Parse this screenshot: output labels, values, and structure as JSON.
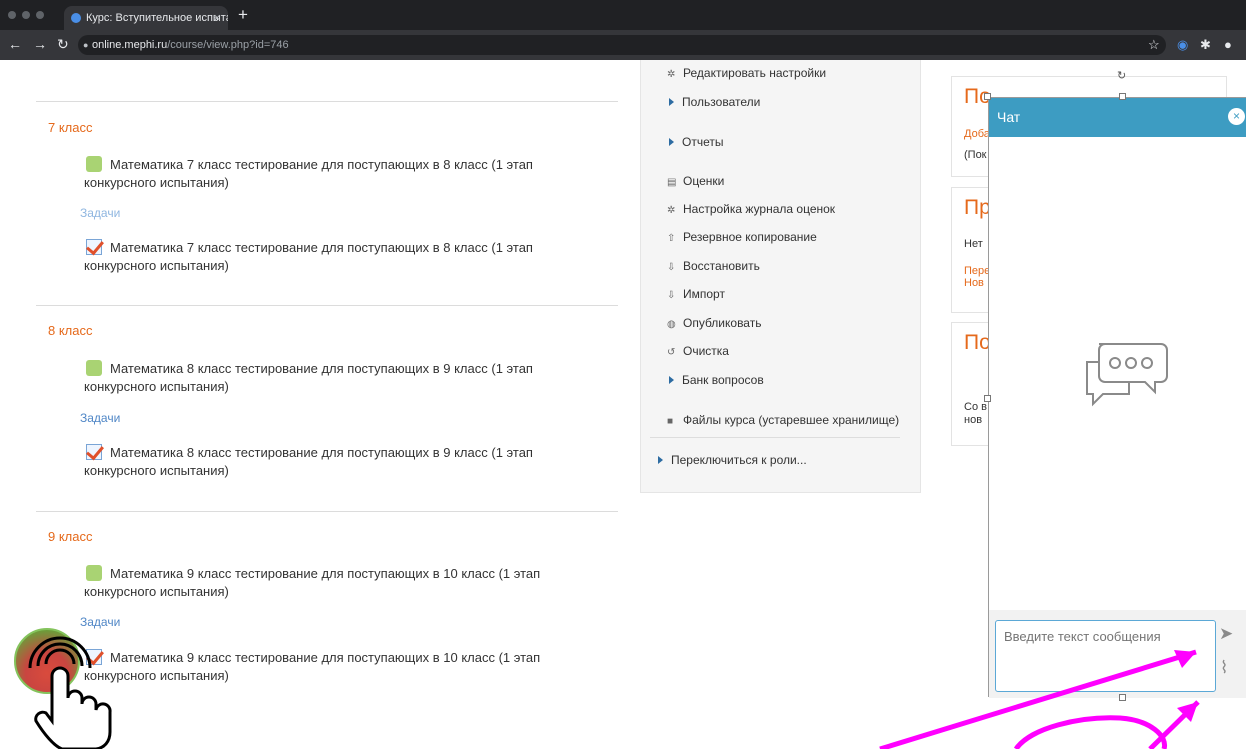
{
  "browser": {
    "tab_title": "Курс: Вступительное испыта",
    "url_domain": "online.mephi.ru",
    "url_path": "/course/view.php?id=746"
  },
  "sections": [
    {
      "title": "7 класс",
      "quiz": "Математика 7 класс тестирование для поступающих в 8 класс (1 этап конкурсного испытания)",
      "tasks": "Задачи",
      "assign": "Математика 7 класс тестирование для поступающих в 8 класс (1 этап конкурсного испытания)"
    },
    {
      "title": "8 класс",
      "quiz": "Математика 8 класс тестирование для поступающих в 9 класс (1 этап конкурсного испытания)",
      "tasks": "Задачи",
      "assign": "Математика 8 класс тестирование для поступающих в 9 класс (1 этап конкурсного испытания)"
    },
    {
      "title": "9 класс",
      "quiz": "Математика 9 класс тестирование для поступающих в 10 класс (1 этап конкурсного испытания)",
      "tasks": "Задачи",
      "assign": "Математика 9 класс тестирование для поступающих в 10 класс (1 этап конкурсного испытания)"
    }
  ],
  "admin": {
    "items": [
      "Редактировать настройки",
      "Пользователи",
      "Отчеты",
      "Оценки",
      "Настройка журнала оценок",
      "Резервное копирование",
      "Восстановить",
      "Импорт",
      "Опубликовать",
      "Очистка",
      "Банк вопросов",
      "Файлы курса (устаревшее хранилище)",
      "Переключиться к роли..."
    ]
  },
  "right_blocks": {
    "news_title": "По",
    "news_link": "Доба",
    "news_text": "(Пок",
    "events_title": "Пр",
    "events_text": "Нет",
    "events_link1": "Пере",
    "events_link2": "Нов",
    "recent_title": "По",
    "recent_text1": "Со в",
    "recent_text2": "нов"
  },
  "chat": {
    "title": "Чат",
    "input_placeholder": "Введите текст сообщения"
  },
  "colors": {
    "accent_orange": "#e5691b",
    "chat_blue": "#3d9cc2",
    "link_blue": "#4f86c6",
    "annotation_magenta": "#ff00ff"
  }
}
